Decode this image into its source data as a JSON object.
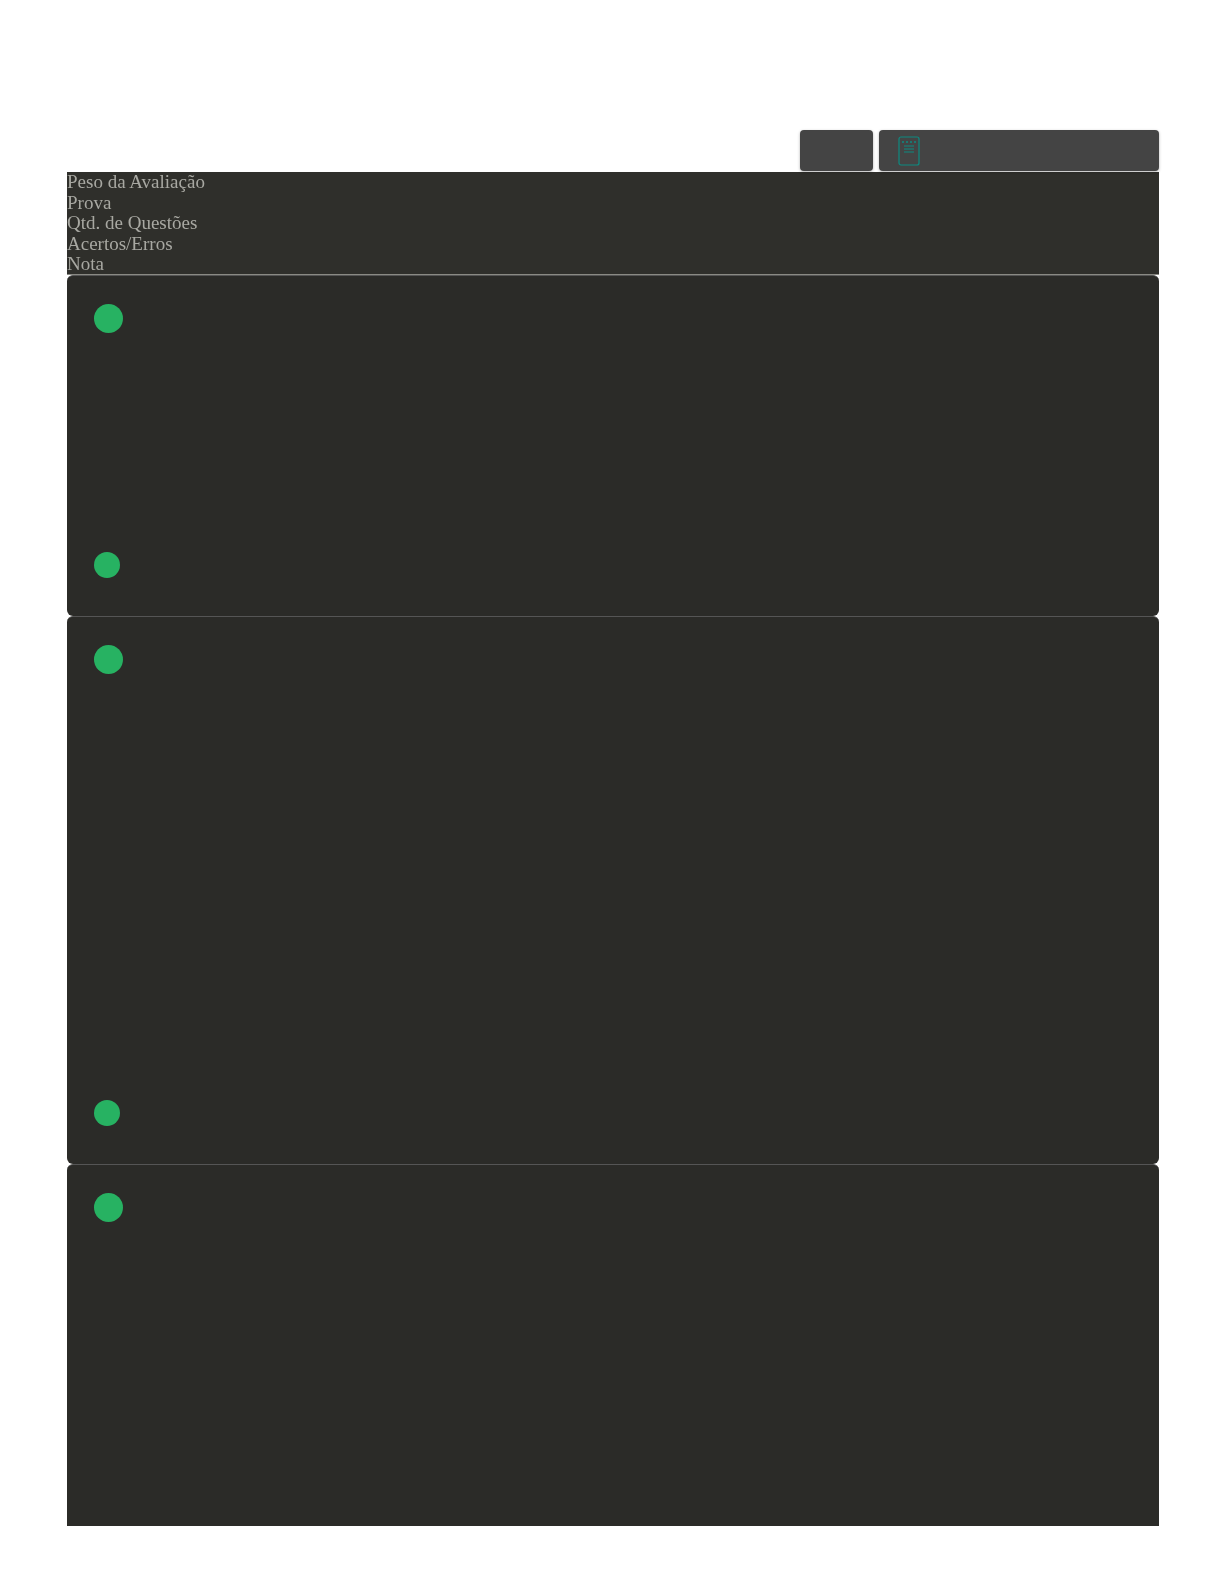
{
  "header": {
    "columns": [
      "Peso da Avaliação",
      "Prova",
      "Qtd. de Questões",
      "Acertos/Erros",
      "Nota"
    ]
  },
  "cards": [
    {
      "markers": [
        {
          "color": "#27b262"
        },
        {
          "color": "#27b262"
        }
      ]
    },
    {
      "markers": [
        {
          "color": "#27b262"
        },
        {
          "color": "#27b262"
        }
      ]
    },
    {
      "markers": [
        {
          "color": "#27b262"
        }
      ]
    }
  ]
}
